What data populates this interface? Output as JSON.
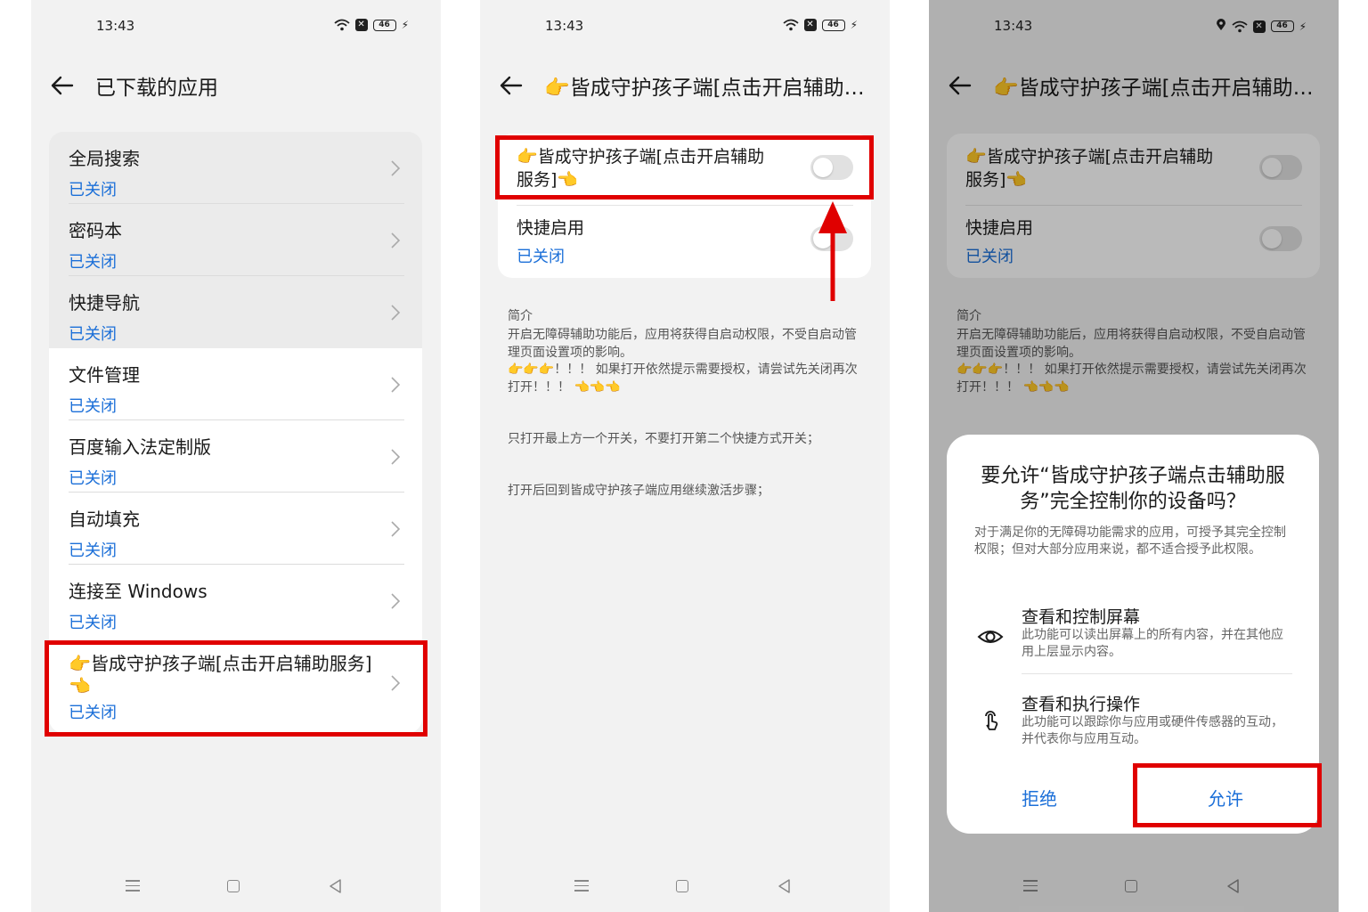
{
  "status": {
    "time": "13:43",
    "battery": "46"
  },
  "panel1": {
    "title": "已下载的应用",
    "items": [
      {
        "name": "全局搜索",
        "state": "已关闭"
      },
      {
        "name": "密码本",
        "state": "已关闭"
      },
      {
        "name": "快捷导航",
        "state": "已关闭"
      },
      {
        "name": "文件管理",
        "state": "已关闭"
      },
      {
        "name": "百度输入法定制版",
        "state": "已关闭"
      },
      {
        "name": "自动填充",
        "state": "已关闭"
      },
      {
        "name": "连接至 Windows",
        "state": "已关闭"
      },
      {
        "name_line1": "👉皆成守护孩子端[点击开启辅助服务]",
        "name_line2": "👈",
        "state": "已关闭"
      }
    ]
  },
  "panel2": {
    "title": "👉皆成守护孩子端[点击开启辅助服...",
    "service_label_line1": "👉皆成守护孩子端[点击开启辅助",
    "service_label_line2": "服务]👈",
    "shortcut_label": "快捷启用",
    "shortcut_state": "已关闭",
    "intro_heading": "简介",
    "intro_text": "开启无障碍辅助功能后，应用将获得自启动权限，不受自启动管理页面设置项的影响。",
    "intro_warning": "👉👉👉！！！ 如果打开依然提示需要授权，请尝试先关闭再次打开！！！ 👈👈👈",
    "intro_note1": "只打开最上方一个开关，不要打开第二个快捷方式开关；",
    "intro_note2": "打开后回到皆成守护孩子端应用继续激活步骤；"
  },
  "panel3": {
    "title": "👉皆成守护孩子端[点击开启辅助服...",
    "service_label_line1": "👉皆成守护孩子端[点击开启辅助",
    "service_label_line2": "服务]👈",
    "shortcut_label": "快捷启用",
    "shortcut_state": "已关闭",
    "intro_heading": "简介",
    "intro_text": "开启无障碍辅助功能后，应用将获得自启动权限，不受自启动管理页面设置项的影响。",
    "intro_warning": "👉👉👉！！！ 如果打开依然提示需要授权，请尝试先关闭再次打开！！！ 👈👈👈",
    "dialog": {
      "title": "要允许“皆成守护孩子端点击辅助服务”完全控制你的设备吗？",
      "description": "对于满足你的无障碍功能需求的应用，可授予其完全控制权限；但对大部分应用来说，都不适合授予此权限。",
      "perm1_title": "查看和控制屏幕",
      "perm1_desc": "此功能可以读出屏幕上的所有内容，并在其他应用上层显示内容。",
      "perm2_title": "查看和执行操作",
      "perm2_desc": "此功能可以跟踪你与应用或硬件传感器的互动，并代表你与应用互动。",
      "deny_label": "拒绝",
      "allow_label": "允许"
    }
  },
  "colors": {
    "accent": "#1b6fd8",
    "highlight": "#e00000"
  }
}
